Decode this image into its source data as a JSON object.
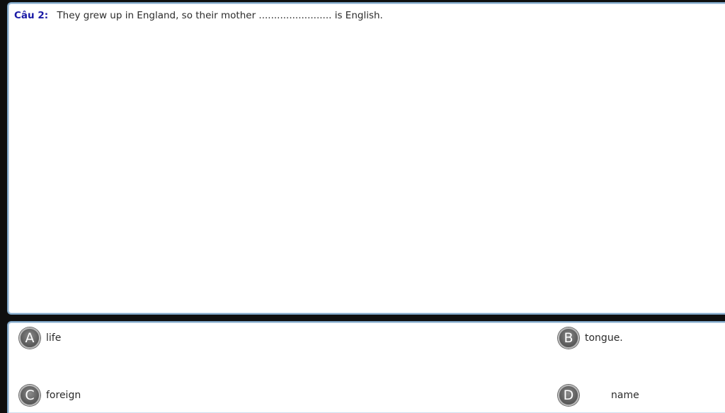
{
  "question": {
    "label": "Câu 2:",
    "text_before": "They grew up in England, so their mother",
    "blank": "........................",
    "text_after": "is English."
  },
  "answers": [
    {
      "letter": "A",
      "text": "life"
    },
    {
      "letter": "B",
      "text": "tongue."
    },
    {
      "letter": "C",
      "text": "foreign"
    },
    {
      "letter": "D",
      "text": "name"
    }
  ]
}
